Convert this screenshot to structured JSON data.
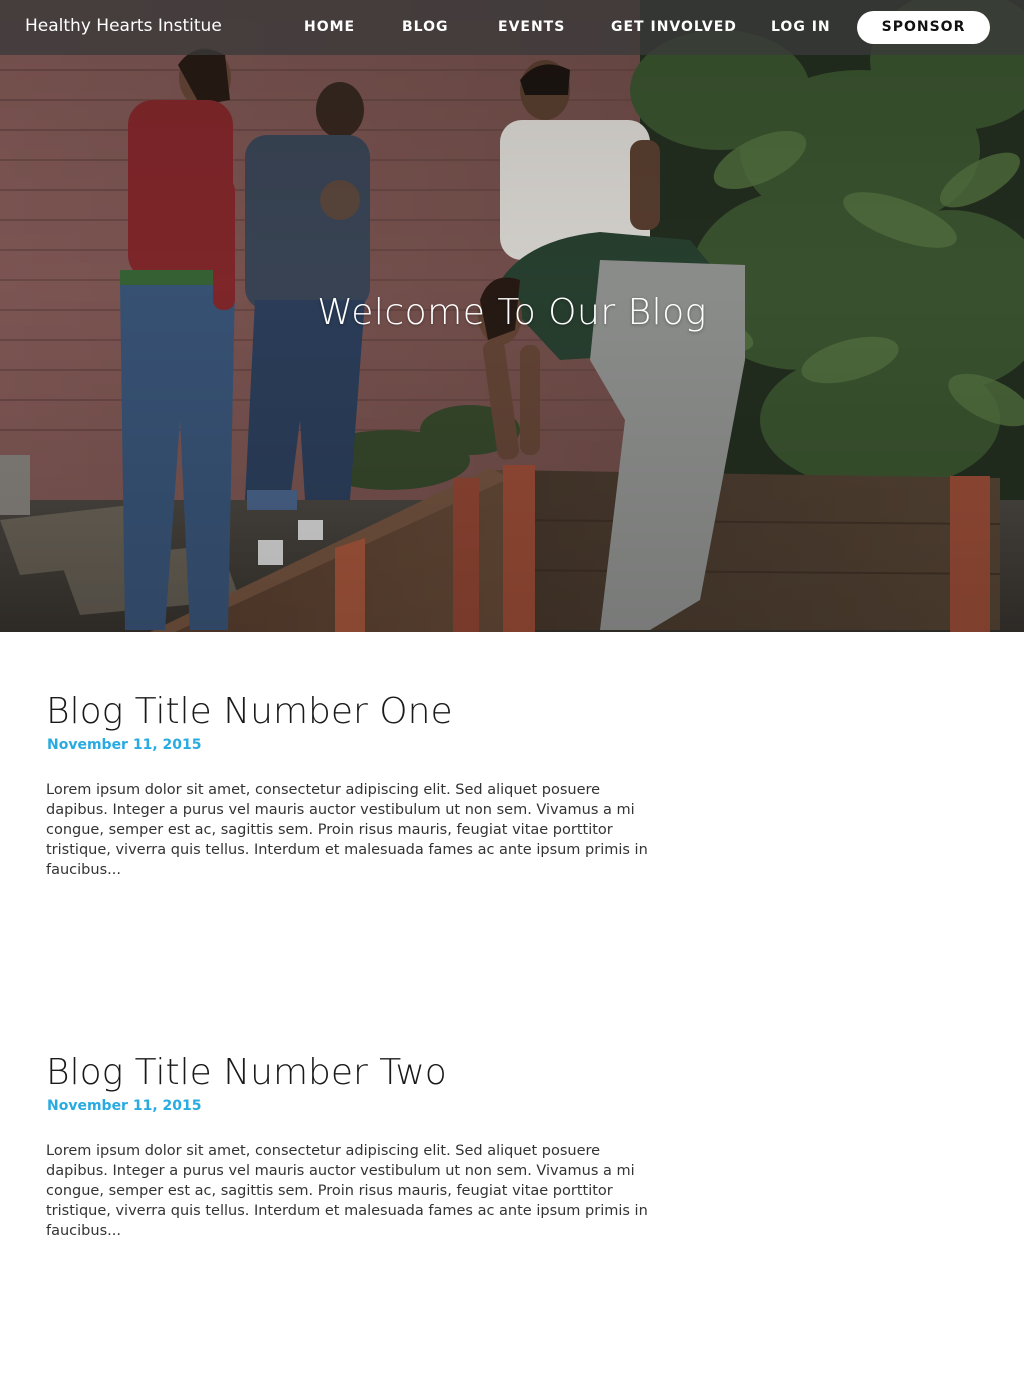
{
  "nav": {
    "brand": "Healthy Hearts Institue",
    "items": [
      {
        "label": "HOME"
      },
      {
        "label": "BLOG"
      },
      {
        "label": "EVENTS"
      },
      {
        "label": "GET INVOLVED"
      },
      {
        "label": "LOG IN"
      }
    ],
    "cta_label": "SPONSOR"
  },
  "hero": {
    "title": "Welcome To Our Blog"
  },
  "posts": [
    {
      "title": "Blog Title Number One",
      "date": "November 11, 2015",
      "excerpt": "Lorem ipsum dolor sit amet, consectetur adipiscing elit. Sed aliquet posuere dapibus. Integer a purus vel mauris auctor vestibulum ut non sem. Vivamus a mi congue, semper est ac, sagittis sem. Proin risus mauris, feugiat vitae porttitor tristique, viverra quis tellus. Interdum et malesuada fames ac ante ipsum primis in faucibus..."
    },
    {
      "title": "Blog Title Number Two",
      "date": "November 11, 2015",
      "excerpt": "Lorem ipsum dolor sit amet, consectetur adipiscing elit. Sed aliquet posuere dapibus. Integer a purus vel mauris auctor vestibulum ut non sem. Vivamus a mi congue, semper est ac, sagittis sem. Proin risus mauris, feugiat vitae porttitor tristique, viverra quis tellus. Interdum et malesuada fames ac ante ipsum primis in faucibus..."
    }
  ],
  "colors": {
    "accent": "#29abe2",
    "nav_background": "#3a3a3a",
    "text": "#333333"
  }
}
